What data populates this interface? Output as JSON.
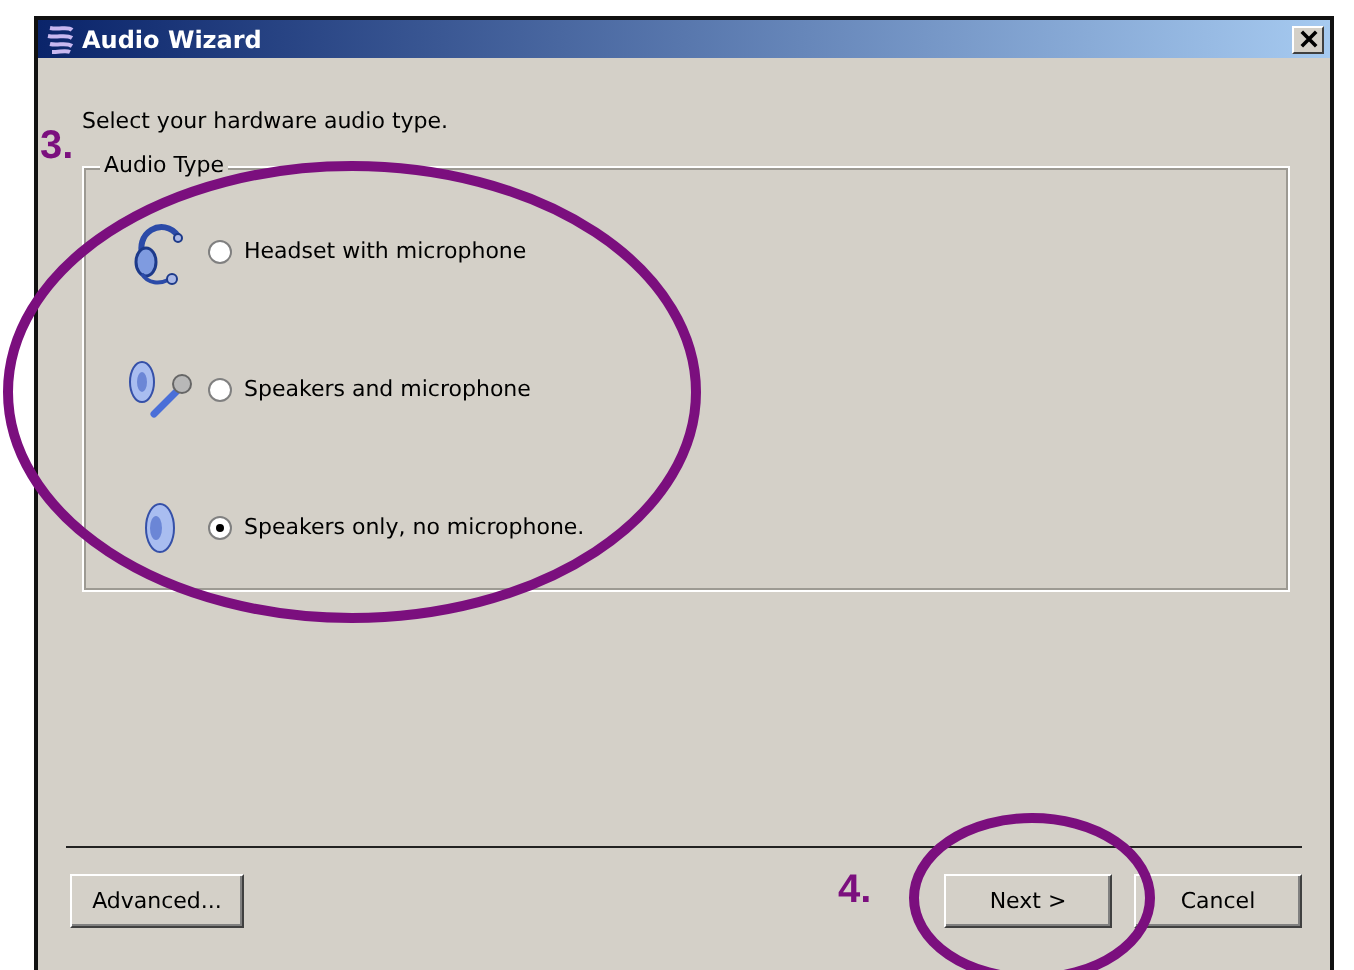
{
  "window": {
    "title": "Audio Wizard"
  },
  "instruction": "Select your hardware audio type.",
  "group": {
    "label": "Audio Type",
    "options": [
      {
        "label": "Headset with microphone",
        "kind": "headset",
        "selected": false
      },
      {
        "label": "Speakers and microphone",
        "kind": "speakers_mic",
        "selected": false
      },
      {
        "label": "Speakers only, no microphone.",
        "kind": "speakers",
        "selected": true
      }
    ]
  },
  "buttons": {
    "advanced": "Advanced...",
    "next": "Next >",
    "cancel": "Cancel"
  },
  "annotations": [
    {
      "label": "3."
    },
    {
      "label": "4."
    }
  ]
}
